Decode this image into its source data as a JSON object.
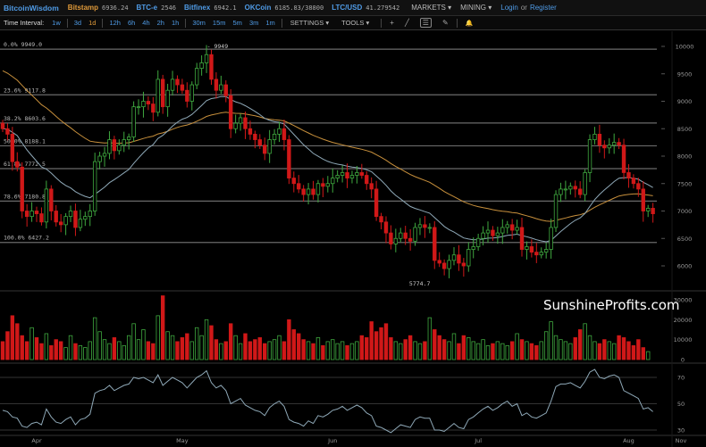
{
  "header": {
    "brand": "BitcoinWisdom",
    "tickers": [
      {
        "name": "Bitstamp",
        "value": "6936.24",
        "active": true
      },
      {
        "name": "BTC-e",
        "value": "2546"
      },
      {
        "name": "Bitfinex",
        "value": "6942.1"
      },
      {
        "name": "OKCoin",
        "value": "6185.83/38800"
      },
      {
        "name": "LTC/USD",
        "value": "41.279542"
      }
    ],
    "markets": "MARKETS ▾",
    "mining": "MINING ▾",
    "login": "Login",
    "or": "or",
    "register": "Register"
  },
  "toolbar": {
    "label": "Time Interval:",
    "intervals": [
      "1w",
      "3d",
      "1d",
      "12h",
      "6h",
      "4h",
      "2h",
      "1h",
      "30m",
      "15m",
      "5m",
      "3m",
      "1m"
    ],
    "selected": "1d",
    "settings": "SETTINGS ▾",
    "tools": "TOOLS ▾",
    "icons": {
      "crosshair": "+",
      "line": "╱",
      "menu": "☰",
      "pen": "✎",
      "alert": "🔔"
    }
  },
  "watermark": "SunshineProfits.com",
  "chart_data": {
    "type": "candlestick",
    "price_axis": {
      "ticks": [
        10000,
        9500,
        9000,
        8500,
        8000,
        7500,
        7000,
        6500,
        6000
      ],
      "range": [
        5700,
        10000
      ]
    },
    "volume_axis": {
      "ticks": [
        30000,
        20000,
        10000,
        0
      ],
      "range": [
        0,
        32000
      ]
    },
    "rsi_axis": {
      "ticks": [
        70,
        50,
        30
      ],
      "range": [
        25,
        80
      ]
    },
    "x_labels": [
      {
        "label": "Apr",
        "day": 7
      },
      {
        "label": "May",
        "day": 37
      },
      {
        "label": "Jun",
        "day": 68
      },
      {
        "label": "Jul",
        "day": 98
      },
      {
        "label": "Aug",
        "day": 129
      },
      {
        "label": "Nov",
        "day": 139
      }
    ],
    "fib_levels": [
      {
        "label": "0.0% 9949.0",
        "price": 9949
      },
      {
        "label": "23.6% 9117.8",
        "price": 9117.8
      },
      {
        "label": "38.2% 8603.6",
        "price": 8603.6
      },
      {
        "label": "50.0% 8188.1",
        "price": 8188.1
      },
      {
        "label": "61.8% 7772.5",
        "price": 7772.5
      },
      {
        "label": "78.6% 7180.8",
        "price": 7180.8
      },
      {
        "label": "100.0% 6427.2",
        "price": 6427.2
      }
    ],
    "annotations": [
      {
        "label": "9949",
        "price": 9949,
        "day": 41
      },
      {
        "label": "5774.7",
        "price": 5774.7,
        "day": 87
      }
    ],
    "first_open": 8600,
    "closes": [
      8500,
      8400,
      7900,
      7800,
      7000,
      6900,
      7000,
      6950,
      6800,
      7400,
      7000,
      6800,
      6750,
      6900,
      7000,
      6700,
      6850,
      6900,
      7000,
      7900,
      8000,
      8050,
      8300,
      8100,
      8200,
      8300,
      8350,
      8900,
      8900,
      9000,
      8950,
      8800,
      9400,
      8900,
      9200,
      9400,
      9300,
      9200,
      9000,
      9300,
      9600,
      9700,
      9850,
      9400,
      9200,
      9300,
      9100,
      8500,
      8600,
      8700,
      8500,
      8400,
      8300,
      8200,
      8050,
      8300,
      8400,
      8500,
      8300,
      7600,
      7500,
      7400,
      7300,
      7400,
      7300,
      7500,
      7450,
      7500,
      7600,
      7650,
      7700,
      7600,
      7650,
      7700,
      7650,
      7500,
      7400,
      6900,
      6800,
      6600,
      6400,
      6500,
      6600,
      6500,
      6450,
      6700,
      6750,
      6700,
      6700,
      6100,
      6050,
      5950,
      6100,
      6200,
      6050,
      6000,
      6300,
      6350,
      6500,
      6600,
      6650,
      6550,
      6600,
      6700,
      6750,
      6650,
      6700,
      6300,
      6350,
      6250,
      6200,
      6250,
      6300,
      6700,
      7300,
      7400,
      7400,
      7450,
      7400,
      7300,
      7700,
      8300,
      8400,
      8200,
      8150,
      8200,
      8250,
      8200,
      7700,
      7600,
      7500,
      7400,
      7000,
      7050,
      6950
    ],
    "volumes": [
      9000,
      14000,
      22000,
      18000,
      12000,
      9000,
      16000,
      11000,
      8000,
      13000,
      7000,
      10000,
      9000,
      6000,
      12000,
      8000,
      7000,
      6000,
      9000,
      21000,
      14000,
      10000,
      8000,
      11000,
      9000,
      7000,
      12000,
      18000,
      10000,
      15000,
      9000,
      8000,
      22000,
      32000,
      14000,
      12000,
      9000,
      11000,
      13000,
      9000,
      16000,
      12000,
      20000,
      17000,
      10000,
      8000,
      9000,
      18000,
      12000,
      8000,
      13000,
      9000,
      10000,
      11000,
      8000,
      9000,
      10000,
      12000,
      9000,
      20000,
      15000,
      13000,
      10000,
      9000,
      8000,
      11000,
      7000,
      9000,
      10000,
      8000,
      9000,
      7000,
      8000,
      9000,
      12000,
      11000,
      19000,
      14000,
      16000,
      18000,
      11000,
      9000,
      8000,
      10000,
      12000,
      9000,
      8000,
      9000,
      21000,
      15000,
      12000,
      10000,
      9000,
      13000,
      8000,
      12000,
      11000,
      9000,
      8000,
      10000,
      7000,
      8000,
      9000,
      8000,
      7000,
      9000,
      13000,
      10000,
      9000,
      8000,
      7000,
      9000,
      14000,
      19000,
      12000,
      10000,
      9000,
      8000,
      11000,
      15000,
      18000,
      12000,
      9000,
      8000,
      10000,
      9000,
      8000,
      12000,
      11000,
      9000,
      7000,
      10000,
      6000,
      4000
    ],
    "rsi": [
      45,
      44,
      40,
      39,
      33,
      32,
      35,
      36,
      34,
      46,
      40,
      36,
      35,
      38,
      40,
      34,
      38,
      39,
      42,
      58,
      60,
      61,
      64,
      60,
      62,
      64,
      65,
      70,
      69,
      70,
      68,
      66,
      72,
      64,
      67,
      70,
      68,
      66,
      62,
      66,
      70,
      72,
      75,
      66,
      62,
      64,
      60,
      50,
      52,
      54,
      49,
      47,
      45,
      44,
      41,
      47,
      50,
      52,
      48,
      38,
      36,
      35,
      33,
      37,
      35,
      41,
      40,
      42,
      45,
      46,
      48,
      45,
      47,
      49,
      47,
      43,
      41,
      33,
      32,
      30,
      28,
      31,
      34,
      33,
      32,
      38,
      40,
      39,
      39,
      30,
      30,
      29,
      32,
      35,
      32,
      31,
      38,
      40,
      43,
      46,
      48,
      45,
      47,
      50,
      52,
      48,
      50,
      41,
      43,
      40,
      39,
      41,
      43,
      52,
      63,
      65,
      65,
      66,
      64,
      62,
      67,
      74,
      76,
      70,
      69,
      71,
      72,
      70,
      60,
      58,
      56,
      54,
      46,
      47,
      44
    ],
    "ma_fast": {
      "period": 20,
      "seed": 8500,
      "color": "#8fa9b8"
    },
    "ma_slow": {
      "period": 50,
      "seed": 9600,
      "color": "#c8903c"
    },
    "colors": {
      "up": "#3fa83f",
      "down": "#d01818",
      "grid": "#555"
    }
  }
}
